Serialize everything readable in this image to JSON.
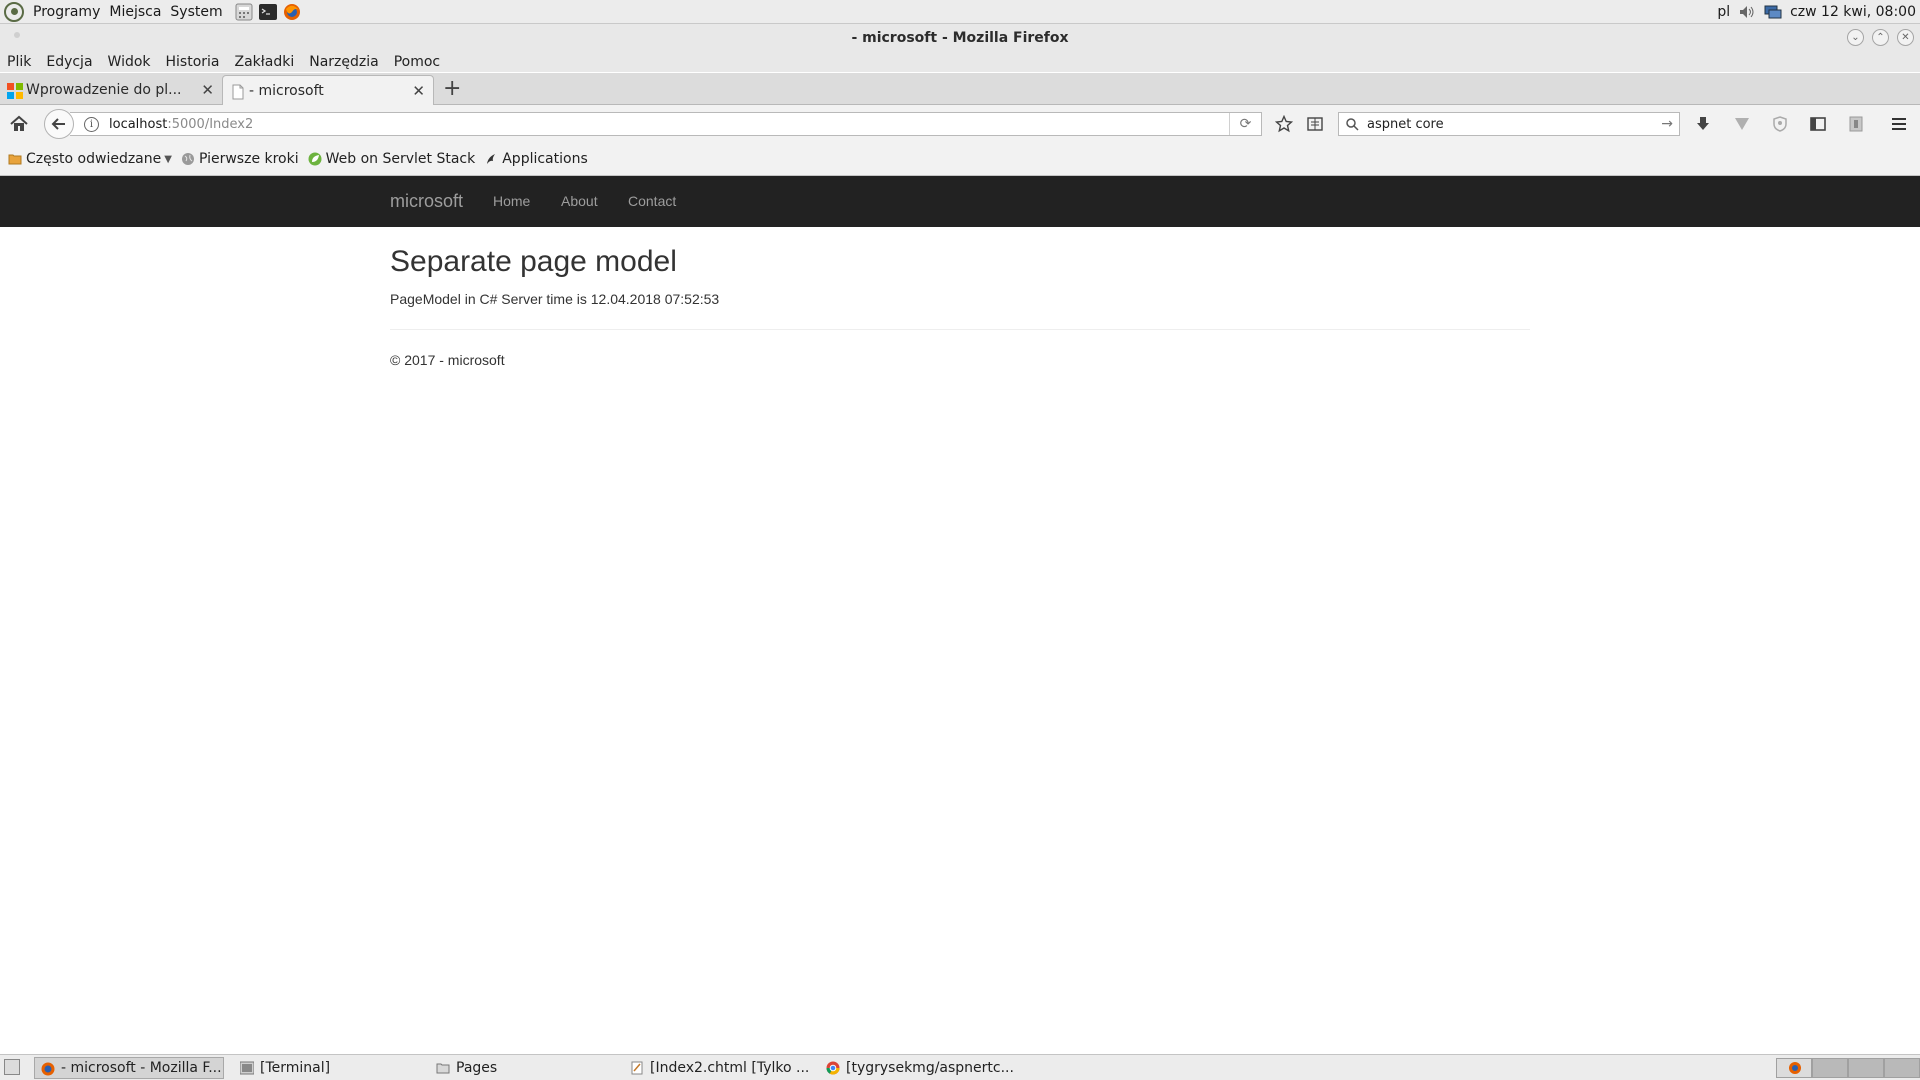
{
  "system_panel": {
    "menus": [
      "Programy",
      "Miejsca",
      "System"
    ],
    "keyboard_layout": "pl",
    "clock": "czw 12 kwi, 08:00"
  },
  "window": {
    "title": "- microsoft - Mozilla Firefox"
  },
  "menubar": [
    "Plik",
    "Edycja",
    "Widok",
    "Historia",
    "Zakładki",
    "Narzędzia",
    "Pomoc"
  ],
  "tabs": [
    {
      "label": "Wprowadzenie do pl...",
      "active": false
    },
    {
      "label": "- microsoft",
      "active": true
    }
  ],
  "urlbar": {
    "host": "localhost",
    "path": ":5000/Index2"
  },
  "searchbar": {
    "value": "aspnet core"
  },
  "bookmarks": [
    "Często odwiedzane",
    "Pierwsze kroki",
    "Web on Servlet Stack",
    "Applications"
  ],
  "site": {
    "brand": "microsoft",
    "nav": [
      "Home",
      "About",
      "Contact"
    ],
    "heading": "Separate page model",
    "text": "PageModel in C# Server time is 12.04.2018 07:52:53",
    "footer": "© 2017 - microsoft"
  },
  "taskbar": [
    {
      "label": "- microsoft - Mozilla F...",
      "active": true,
      "icon": "firefox-icon"
    },
    {
      "label": "[Terminal]",
      "active": false,
      "icon": "terminal-icon"
    },
    {
      "label": "Pages",
      "active": false,
      "icon": "folder-icon"
    },
    {
      "label": "[Index2.chtml [Tylko ...",
      "active": false,
      "icon": "text-editor-icon"
    },
    {
      "label": "[tygrysekmg/aspnertc...",
      "active": false,
      "icon": "chrome-icon"
    }
  ],
  "colors": {
    "site_navbar": "#222222",
    "site_nav_text": "#9d9d9d"
  }
}
